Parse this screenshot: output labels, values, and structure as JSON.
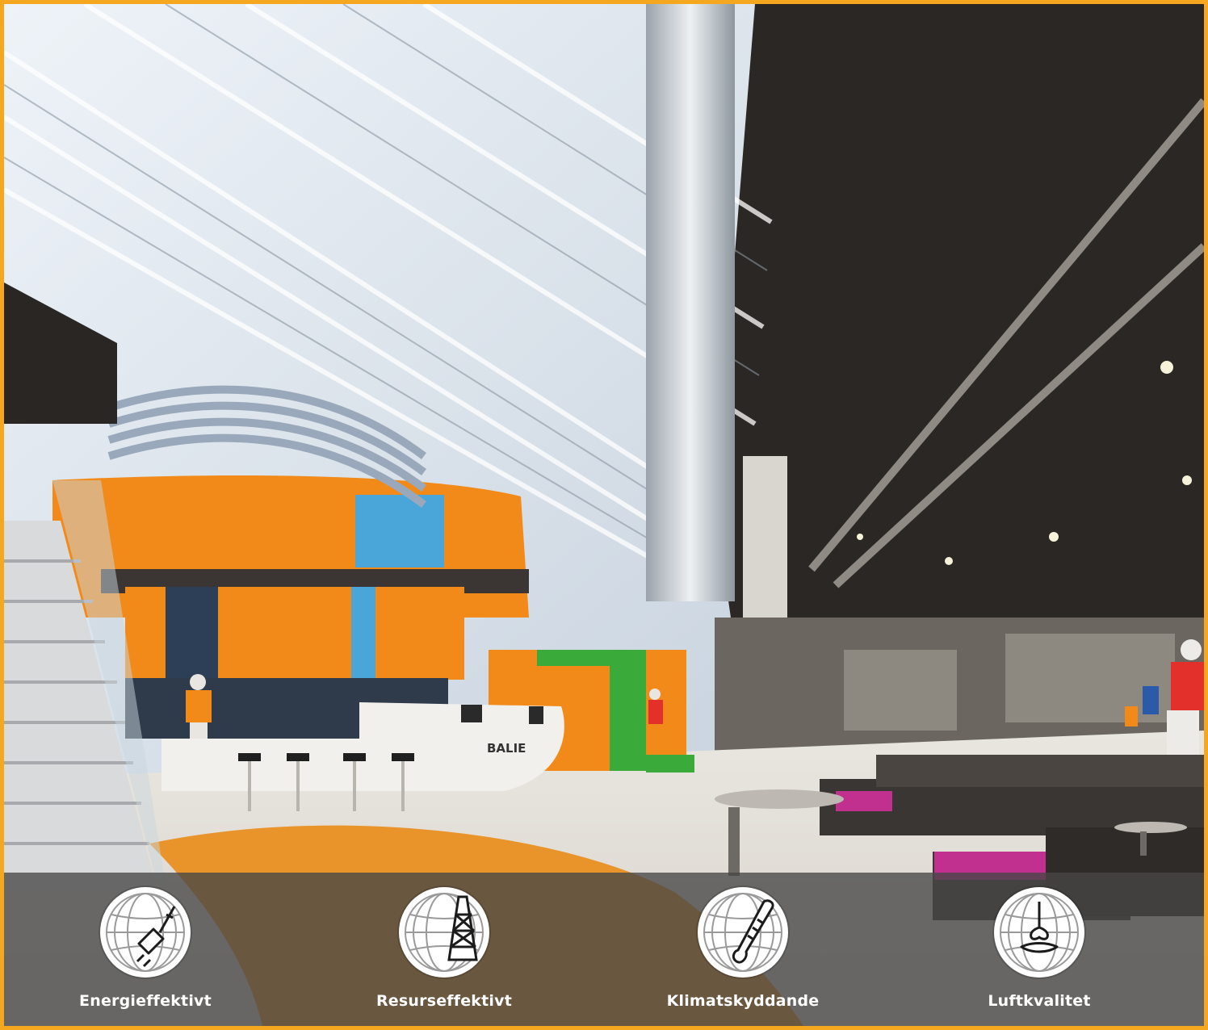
{
  "scene": {
    "counter_sign": "BALIE"
  },
  "features": [
    {
      "label": "Energieffektivt",
      "icon": "globe-plug-icon"
    },
    {
      "label": "Resurseffektivt",
      "icon": "globe-oil-rig-icon"
    },
    {
      "label": "Klimatskyddande",
      "icon": "globe-thermometer-icon"
    },
    {
      "label": "Luftkvalitet",
      "icon": "globe-nose-icon"
    }
  ],
  "colors": {
    "frame": "#f4a71f",
    "orange": "#f28a1a",
    "blue": "#4aa6d8",
    "green": "#3aaa3a",
    "magenta": "#c2308f",
    "overlay": "#464646"
  }
}
